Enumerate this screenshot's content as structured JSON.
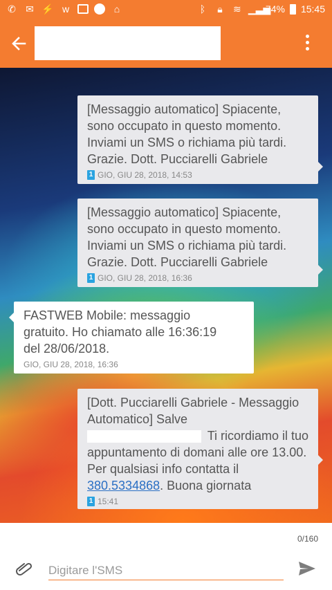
{
  "status_bar": {
    "battery_percent": "74%",
    "time": "15:45"
  },
  "app_bar": {
    "contact_name": ""
  },
  "messages": [
    {
      "direction": "outgoing",
      "text": "[Messaggio automatico] Spiacente, sono occupato in questo momento. Inviami un SMS o richiama più tardi. Grazie. Dott. Pucciarelli Gabriele",
      "sim": "1",
      "timestamp": "GIO, GIU 28, 2018, 14:53"
    },
    {
      "direction": "outgoing",
      "text": "[Messaggio automatico] Spiacente, sono occupato in questo momento. Inviami un SMS o richiama più tardi. Grazie. Dott. Pucciarelli Gabriele",
      "sim": "1",
      "timestamp": "GIO, GIU 28, 2018, 16:36"
    },
    {
      "direction": "incoming",
      "text": "FASTWEB Mobile: messaggio gratuito. Ho chiamato alle 16:36:19 del 28/06/2018.",
      "timestamp": "GIO, GIU 28, 2018, 16:36"
    },
    {
      "direction": "outgoing",
      "text_part1": "[Dott. Pucciarelli Gabriele - Messaggio Automatico] Salve",
      "text_part2": "Ti ricordiamo il tuo appuntamento di domani alle ore 13.00. Per qualsiasi info contatta il",
      "phone_link": "380.5334868",
      "text_part3": ". Buona giornata",
      "sim": "1",
      "timestamp": "15:41"
    }
  ],
  "composer": {
    "char_counter": "0/160",
    "placeholder": "Digitare l'SMS",
    "value": ""
  },
  "colors": {
    "accent": "#f47c30",
    "link": "#2a6fc4"
  }
}
